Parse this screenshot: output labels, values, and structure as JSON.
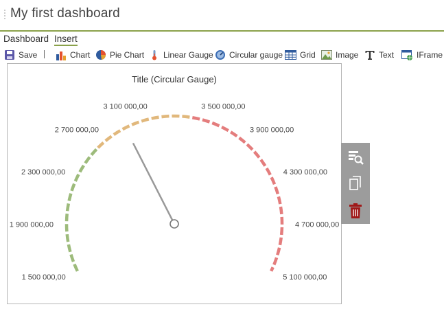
{
  "header": {
    "title": "My first dashboard"
  },
  "menu": {
    "items": [
      {
        "label": "Dashboard"
      },
      {
        "label": "Insert"
      }
    ]
  },
  "toolbar": {
    "save": "Save",
    "separator": "|",
    "items": [
      {
        "label": "Chart",
        "icon": "bar-chart-icon"
      },
      {
        "label": "Pie Chart",
        "icon": "pie-chart-icon"
      },
      {
        "label": "Linear Gauge",
        "icon": "linear-gauge-icon"
      },
      {
        "label": "Circular gauge",
        "icon": "circular-gauge-icon"
      },
      {
        "label": "Grid",
        "icon": "grid-icon"
      },
      {
        "label": "Image",
        "icon": "image-icon"
      },
      {
        "label": "Text",
        "icon": "text-icon"
      },
      {
        "label": "IFrame",
        "icon": "iframe-icon"
      }
    ]
  },
  "widget": {
    "title": "Title (Circular Gauge)",
    "gauge": {
      "min": 1500000,
      "max": 5100000,
      "value": 2880000,
      "ticks": [
        "1 500 000,00",
        "1 900 000,00",
        "2 300 000,00",
        "2 700 000,00",
        "3 100 000,00",
        "3 500 000,00",
        "3 900 000,00",
        "4 300 000,00",
        "4 700 000,00",
        "5 100 000,00"
      ],
      "bands": [
        {
          "from": 1500000,
          "to": 2600000,
          "color": "#9dbb7b"
        },
        {
          "from": 2600000,
          "to": 3450000,
          "color": "#e1b87c"
        },
        {
          "from": 3450000,
          "to": 5100000,
          "color": "#e47d7d"
        }
      ],
      "needle_color": "#999999"
    }
  },
  "side_panel": {
    "buttons": [
      "preview-icon",
      "copy-icon",
      "delete-icon"
    ],
    "delete_color": "#a01818"
  },
  "colors": {
    "accent": "#8aa14a"
  }
}
